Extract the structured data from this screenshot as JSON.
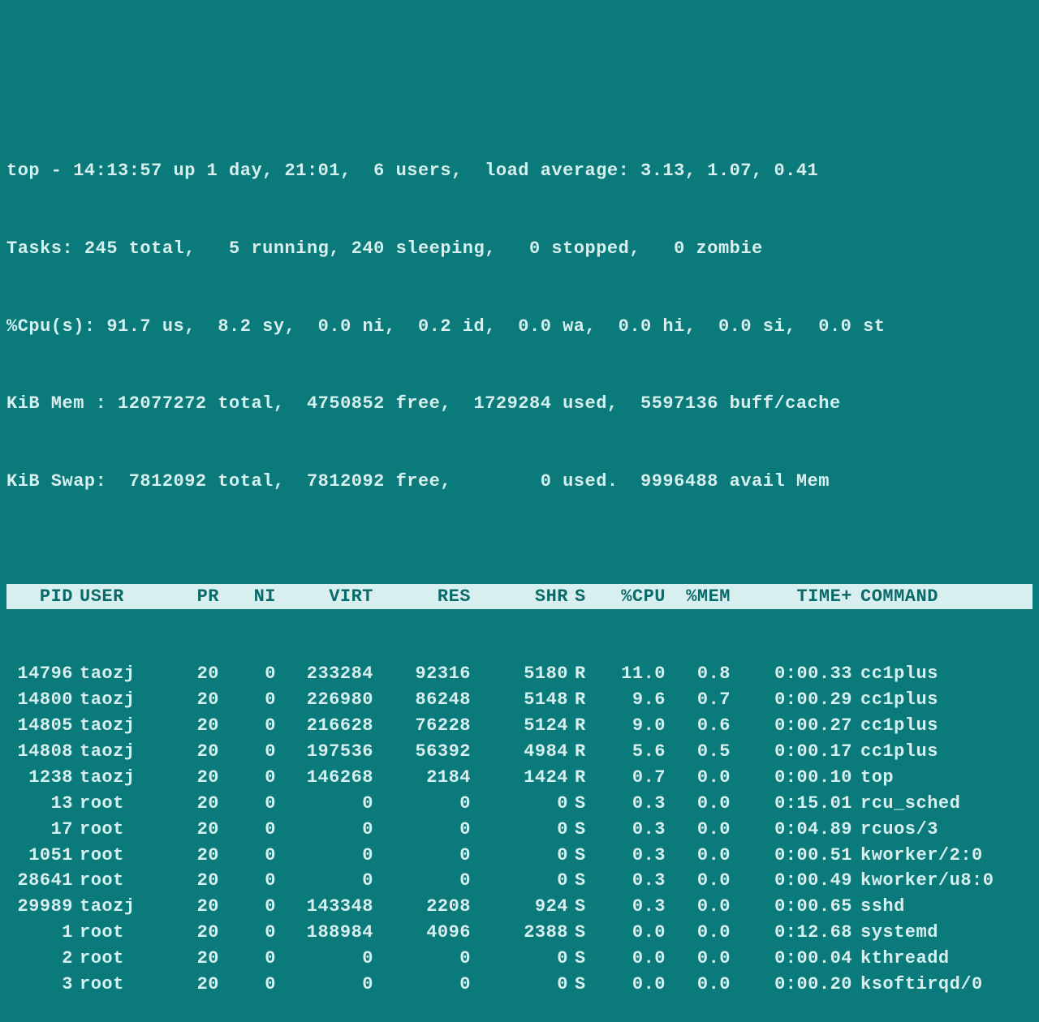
{
  "summary": {
    "line1": "top - 14:13:57 up 1 day, 21:01,  6 users,  load average: 3.13, 1.07, 0.41",
    "line2": "Tasks: 245 total,   5 running, 240 sleeping,   0 stopped,   0 zombie",
    "line3": "%Cpu(s): 91.7 us,  8.2 sy,  0.0 ni,  0.2 id,  0.0 wa,  0.0 hi,  0.0 si,  0.0 st",
    "line4": "KiB Mem : 12077272 total,  4750852 free,  1729284 used,  5597136 buff/cache",
    "line5": "KiB Swap:  7812092 total,  7812092 free,        0 used.  9996488 avail Mem"
  },
  "headers": {
    "pid": "PID",
    "user": "USER",
    "pr": "PR",
    "ni": "NI",
    "virt": "VIRT",
    "res": "RES",
    "shr": "SHR",
    "s": "S",
    "cpu": "%CPU",
    "mem": "%MEM",
    "time": "TIME+",
    "cmd": "COMMAND"
  },
  "processes": [
    {
      "pid": "14796",
      "user": "taozj",
      "pr": "20",
      "ni": "0",
      "virt": "233284",
      "res": "92316",
      "shr": "5180",
      "s": "R",
      "cpu": "11.0",
      "mem": "0.8",
      "time": "0:00.33",
      "cmd": "cc1plus"
    },
    {
      "pid": "14800",
      "user": "taozj",
      "pr": "20",
      "ni": "0",
      "virt": "226980",
      "res": "86248",
      "shr": "5148",
      "s": "R",
      "cpu": "9.6",
      "mem": "0.7",
      "time": "0:00.29",
      "cmd": "cc1plus"
    },
    {
      "pid": "14805",
      "user": "taozj",
      "pr": "20",
      "ni": "0",
      "virt": "216628",
      "res": "76228",
      "shr": "5124",
      "s": "R",
      "cpu": "9.0",
      "mem": "0.6",
      "time": "0:00.27",
      "cmd": "cc1plus"
    },
    {
      "pid": "14808",
      "user": "taozj",
      "pr": "20",
      "ni": "0",
      "virt": "197536",
      "res": "56392",
      "shr": "4984",
      "s": "R",
      "cpu": "5.6",
      "mem": "0.5",
      "time": "0:00.17",
      "cmd": "cc1plus"
    },
    {
      "pid": "1238",
      "user": "taozj",
      "pr": "20",
      "ni": "0",
      "virt": "146268",
      "res": "2184",
      "shr": "1424",
      "s": "R",
      "cpu": "0.7",
      "mem": "0.0",
      "time": "0:00.10",
      "cmd": "top"
    },
    {
      "pid": "13",
      "user": "root",
      "pr": "20",
      "ni": "0",
      "virt": "0",
      "res": "0",
      "shr": "0",
      "s": "S",
      "cpu": "0.3",
      "mem": "0.0",
      "time": "0:15.01",
      "cmd": "rcu_sched"
    },
    {
      "pid": "17",
      "user": "root",
      "pr": "20",
      "ni": "0",
      "virt": "0",
      "res": "0",
      "shr": "0",
      "s": "S",
      "cpu": "0.3",
      "mem": "0.0",
      "time": "0:04.89",
      "cmd": "rcuos/3"
    },
    {
      "pid": "1051",
      "user": "root",
      "pr": "20",
      "ni": "0",
      "virt": "0",
      "res": "0",
      "shr": "0",
      "s": "S",
      "cpu": "0.3",
      "mem": "0.0",
      "time": "0:00.51",
      "cmd": "kworker/2:0"
    },
    {
      "pid": "28641",
      "user": "root",
      "pr": "20",
      "ni": "0",
      "virt": "0",
      "res": "0",
      "shr": "0",
      "s": "S",
      "cpu": "0.3",
      "mem": "0.0",
      "time": "0:00.49",
      "cmd": "kworker/u8:0"
    },
    {
      "pid": "29989",
      "user": "taozj",
      "pr": "20",
      "ni": "0",
      "virt": "143348",
      "res": "2208",
      "shr": "924",
      "s": "S",
      "cpu": "0.3",
      "mem": "0.0",
      "time": "0:00.65",
      "cmd": "sshd"
    },
    {
      "pid": "1",
      "user": "root",
      "pr": "20",
      "ni": "0",
      "virt": "188984",
      "res": "4096",
      "shr": "2388",
      "s": "S",
      "cpu": "0.0",
      "mem": "0.0",
      "time": "0:12.68",
      "cmd": "systemd"
    },
    {
      "pid": "2",
      "user": "root",
      "pr": "20",
      "ni": "0",
      "virt": "0",
      "res": "0",
      "shr": "0",
      "s": "S",
      "cpu": "0.0",
      "mem": "0.0",
      "time": "0:00.04",
      "cmd": "kthreadd"
    },
    {
      "pid": "3",
      "user": "root",
      "pr": "20",
      "ni": "0",
      "virt": "0",
      "res": "0",
      "shr": "0",
      "s": "S",
      "cpu": "0.0",
      "mem": "0.0",
      "time": "0:00.20",
      "cmd": "ksoftirqd/0"
    }
  ]
}
